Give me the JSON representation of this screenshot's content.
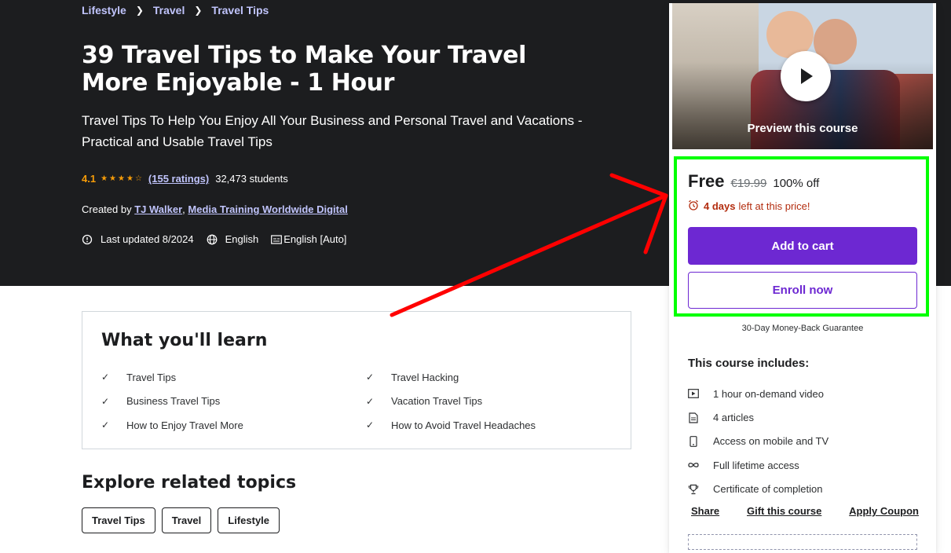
{
  "breadcrumbs": [
    "Lifestyle",
    "Travel",
    "Travel Tips"
  ],
  "course": {
    "title": "39 Travel Tips to Make Your Travel More Enjoyable - 1 Hour",
    "subtitle": "Travel Tips To Help You Enjoy All Your Business and Personal Travel and Vacations - Practical and Usable Travel Tips",
    "rating": "4.1",
    "rating_stars": 4.1,
    "ratings_count": "(155 ratings)",
    "students": "32,473 students",
    "created_by_label": "Created by",
    "instructors": [
      "TJ Walker",
      "Media Training Worldwide Digital"
    ],
    "last_updated": "Last updated 8/2024",
    "language": "English",
    "captions": "English [Auto]"
  },
  "sidebar": {
    "preview_label": "Preview this course",
    "price": "Free",
    "original_price": "€19.99",
    "discount": "100% off",
    "timer_days": "4 days",
    "timer_suffix": "left at this price!",
    "add_to_cart": "Add to cart",
    "enroll_now": "Enroll now",
    "guarantee": "30-Day Money-Back Guarantee",
    "includes_title": "This course includes:",
    "includes": [
      {
        "icon": "video-icon",
        "label": "1 hour on-demand video"
      },
      {
        "icon": "article-icon",
        "label": "4 articles"
      },
      {
        "icon": "mobile-icon",
        "label": "Access on mobile and TV"
      },
      {
        "icon": "infinity-icon",
        "label": "Full lifetime access"
      },
      {
        "icon": "trophy-icon",
        "label": "Certificate of completion"
      }
    ],
    "links": [
      "Share",
      "Gift this course",
      "Apply Coupon"
    ]
  },
  "learn": {
    "title": "What you'll learn",
    "left": [
      "Travel Tips",
      "Business Travel Tips",
      "How to Enjoy Travel More"
    ],
    "right": [
      "Travel Hacking",
      "Vacation Travel Tips",
      "How to Avoid Travel Headaches"
    ]
  },
  "explore": {
    "title": "Explore related topics",
    "topics": [
      "Travel Tips",
      "Travel",
      "Lifestyle"
    ]
  },
  "colors": {
    "hero_bg": "#1c1d1f",
    "accent": "#6d28d2",
    "link": "#c0c4fc",
    "star": "#f69c08",
    "timer": "#b32d0f",
    "highlight": "#00ff00",
    "annotation_arrow": "#ff0000"
  }
}
